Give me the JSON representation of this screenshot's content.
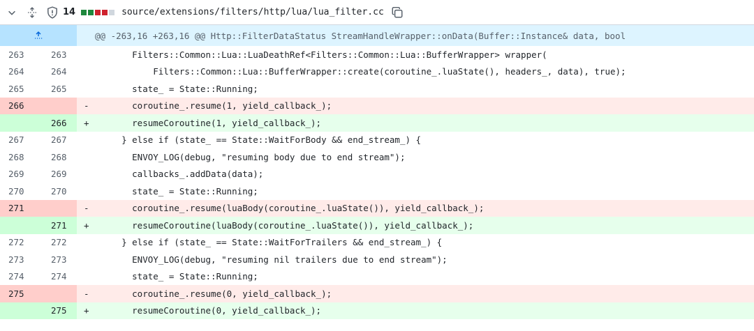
{
  "file": {
    "change_count": "14",
    "path": "source/extensions/filters/http/lua/lua_filter.cc",
    "diffstat_colors": [
      "#1f883d",
      "#1f883d",
      "#cf222e",
      "#cf222e",
      "#d0d7de"
    ]
  },
  "hunk": {
    "header": "@@ -263,16 +263,16 @@ Http::FilterDataStatus StreamHandleWrapper::onData(Buffer::Instance& data, bool"
  },
  "lines": [
    {
      "type": "ctx",
      "old": "263",
      "new": "263",
      "sign": "",
      "code": "      Filters::Common::Lua::LuaDeathRef<Filters::Common::Lua::BufferWrapper> wrapper("
    },
    {
      "type": "ctx",
      "old": "264",
      "new": "264",
      "sign": "",
      "code": "          Filters::Common::Lua::BufferWrapper::create(coroutine_.luaState(), headers_, data), true);"
    },
    {
      "type": "ctx",
      "old": "265",
      "new": "265",
      "sign": "",
      "code": "      state_ = State::Running;"
    },
    {
      "type": "del",
      "old": "266",
      "new": "",
      "sign": "-",
      "code": "      coroutine_.resume(1, yield_callback_);"
    },
    {
      "type": "add",
      "old": "",
      "new": "266",
      "sign": "+",
      "code": "      resumeCoroutine(1, yield_callback_);"
    },
    {
      "type": "ctx",
      "old": "267",
      "new": "267",
      "sign": "",
      "code": "    } else if (state_ == State::WaitForBody && end_stream_) {"
    },
    {
      "type": "ctx",
      "old": "268",
      "new": "268",
      "sign": "",
      "code": "      ENVOY_LOG(debug, \"resuming body due to end stream\");"
    },
    {
      "type": "ctx",
      "old": "269",
      "new": "269",
      "sign": "",
      "code": "      callbacks_.addData(data);"
    },
    {
      "type": "ctx",
      "old": "270",
      "new": "270",
      "sign": "",
      "code": "      state_ = State::Running;"
    },
    {
      "type": "del",
      "old": "271",
      "new": "",
      "sign": "-",
      "code": "      coroutine_.resume(luaBody(coroutine_.luaState()), yield_callback_);"
    },
    {
      "type": "add",
      "old": "",
      "new": "271",
      "sign": "+",
      "code": "      resumeCoroutine(luaBody(coroutine_.luaState()), yield_callback_);"
    },
    {
      "type": "ctx",
      "old": "272",
      "new": "272",
      "sign": "",
      "code": "    } else if (state_ == State::WaitForTrailers && end_stream_) {"
    },
    {
      "type": "ctx",
      "old": "273",
      "new": "273",
      "sign": "",
      "code": "      ENVOY_LOG(debug, \"resuming nil trailers due to end stream\");"
    },
    {
      "type": "ctx",
      "old": "274",
      "new": "274",
      "sign": "",
      "code": "      state_ = State::Running;"
    },
    {
      "type": "del",
      "old": "275",
      "new": "",
      "sign": "-",
      "code": "      coroutine_.resume(0, yield_callback_);"
    },
    {
      "type": "add",
      "old": "",
      "new": "275",
      "sign": "+",
      "code": "      resumeCoroutine(0, yield_callback_);"
    }
  ]
}
